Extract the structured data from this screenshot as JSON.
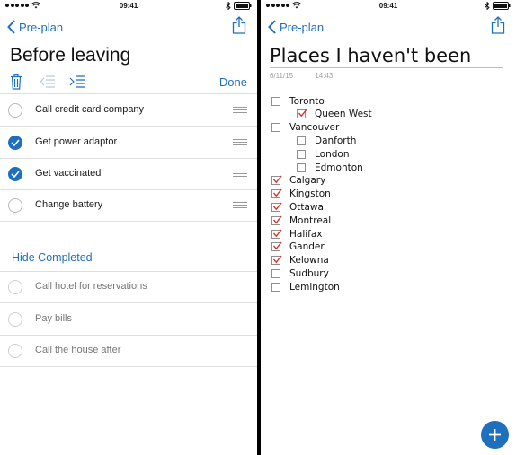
{
  "left": {
    "status": {
      "time": "09:41"
    },
    "nav": {
      "back_label": "Pre-plan"
    },
    "title": "Before leaving",
    "toolbar": {
      "done_label": "Done"
    },
    "tasks": [
      {
        "label": "Call credit card company",
        "checked": false
      },
      {
        "label": "Get power adaptor",
        "checked": true
      },
      {
        "label": "Get vaccinated",
        "checked": true
      },
      {
        "label": "Change battery",
        "checked": false
      }
    ],
    "hide_completed_label": "Hide Completed",
    "completed_tasks": [
      {
        "label": "Call hotel for reservations"
      },
      {
        "label": "Pay bills"
      },
      {
        "label": "Call the house after"
      }
    ]
  },
  "right": {
    "status": {
      "time": "09:41"
    },
    "nav": {
      "back_label": "Pre-plan"
    },
    "title": "Places I haven't been",
    "date": "6/11/15",
    "time": "14:43",
    "checklist": [
      {
        "label": "Toronto",
        "checked": false,
        "level": 0
      },
      {
        "label": "Queen West",
        "checked": true,
        "level": 1
      },
      {
        "label": "Vancouver",
        "checked": false,
        "level": 0
      },
      {
        "label": "Danforth",
        "checked": false,
        "level": 1
      },
      {
        "label": "London",
        "checked": false,
        "level": 1
      },
      {
        "label": "Edmonton",
        "checked": false,
        "level": 1
      },
      {
        "label": "Calgary",
        "checked": true,
        "level": 0
      },
      {
        "label": "Kingston",
        "checked": true,
        "level": 0
      },
      {
        "label": "Ottawa",
        "checked": true,
        "level": 0
      },
      {
        "label": "Montreal",
        "checked": true,
        "level": 0
      },
      {
        "label": "Halifax",
        "checked": true,
        "level": 0
      },
      {
        "label": "Gander",
        "checked": true,
        "level": 0
      },
      {
        "label": "Kelowna",
        "checked": true,
        "level": 0
      },
      {
        "label": "Sudbury",
        "checked": false,
        "level": 0
      },
      {
        "label": "Lemington",
        "checked": false,
        "level": 0
      }
    ]
  },
  "colors": {
    "accent": "#1f6fbf",
    "checkmark_red": "#d9312c"
  },
  "icons": [
    "chevron-left-icon",
    "share-icon",
    "trash-icon",
    "outdent-icon",
    "indent-icon",
    "drag-handle-icon",
    "plus-icon",
    "wifi-icon",
    "bluetooth-icon",
    "battery-icon"
  ]
}
